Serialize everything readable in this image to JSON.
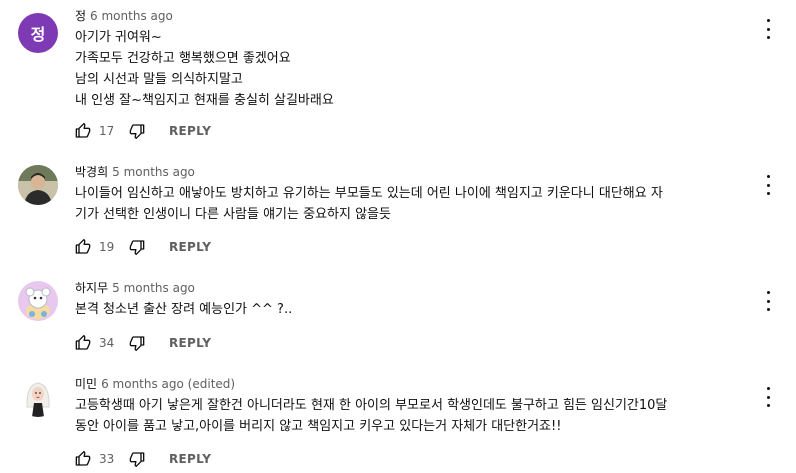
{
  "comments": [
    {
      "avatar_letter": "정",
      "author": "정",
      "time": "6 months ago",
      "lines": [
        "아기가 귀여워~",
        "가족모두 건강하고 행복했으면 좋겠어요",
        "남의 시선과 말들 의식하지말고",
        "내 인생 잘~책임지고 현재를 충실히 살길바래요"
      ],
      "likes": "17",
      "reply": "REPLY"
    },
    {
      "author": "박경희",
      "time": "5 months ago",
      "lines": [
        "나이들어 임신하고 애낳아도 방치하고 유기하는 부모들도 있는데 어린 나이에 책임지고 키운다니 대단해요 자",
        "기가 선택한 인생이니 다른 사람들 얘기는 중요하지 않을듯"
      ],
      "likes": "19",
      "reply": "REPLY"
    },
    {
      "author": "하지무",
      "time": "5 months ago",
      "lines": [
        "본격 청소년 출산 장려 예능인가 ^^ ?.."
      ],
      "likes": "34",
      "reply": "REPLY"
    },
    {
      "author": "미민",
      "time": "6 months ago (edited)",
      "lines": [
        "고등학생때 아기 낳은게 잘한건 아니더라도 현재 한 아이의 부모로서 학생인데도 불구하고 힘든 임신기간10달",
        "동안 아이를 품고 낳고,아이를 버리지 않고 책임지고 키우고 있다는거 자체가 대단한거죠!!"
      ],
      "likes": "33",
      "reply": "REPLY"
    }
  ],
  "colors": {
    "avatar_bg": "#7e3ab4",
    "meta_text": "#606060",
    "text": "#0f0f0f"
  },
  "icons": {
    "like": "thumbs-up-icon",
    "dislike": "thumbs-down-icon",
    "menu": "more-vertical-icon"
  }
}
